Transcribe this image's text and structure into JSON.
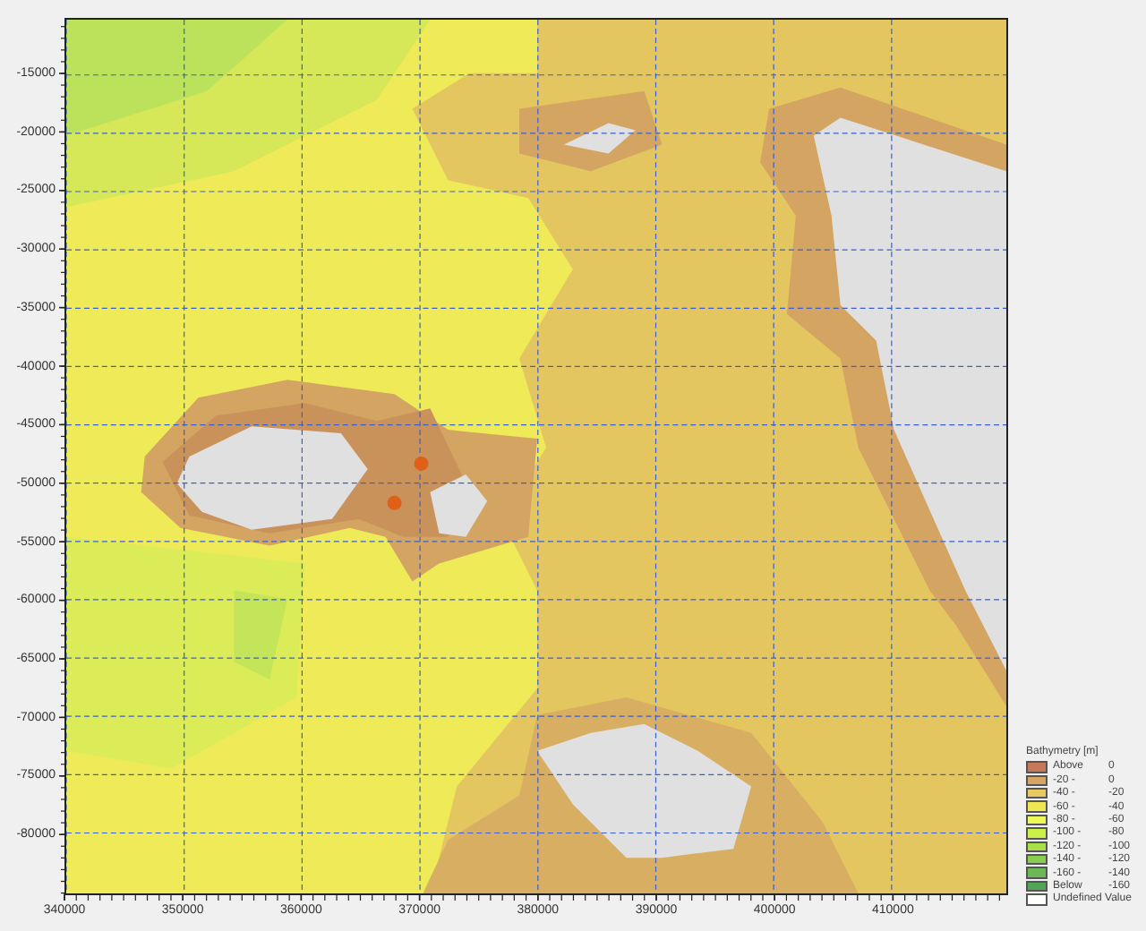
{
  "plot": {
    "y_ticks": [
      "-15000",
      "-20000",
      "-25000",
      "-30000",
      "-35000",
      "-40000",
      "-45000",
      "-50000",
      "-55000",
      "-60000",
      "-65000",
      "-70000",
      "-75000",
      "-80000"
    ],
    "x_ticks": [
      "340000",
      "350000",
      "360000",
      "370000",
      "380000",
      "390000",
      "400000",
      "410000"
    ]
  },
  "legend": {
    "title": "Bathymetry [m]",
    "items": [
      {
        "from": "Above",
        "to": "0",
        "color": "#c8785a"
      },
      {
        "from": "-20 -",
        "to": "0",
        "color": "#d8a464"
      },
      {
        "from": "-40 -",
        "to": "-20",
        "color": "#e8c860"
      },
      {
        "from": "-60 -",
        "to": "-40",
        "color": "#f0e654"
      },
      {
        "from": "-80 -",
        "to": "-60",
        "color": "#eef858"
      },
      {
        "from": "-100 -",
        "to": "-80",
        "color": "#ccf048"
      },
      {
        "from": "-120 -",
        "to": "-100",
        "color": "#a8e048"
      },
      {
        "from": "-140 -",
        "to": "-120",
        "color": "#88cc50"
      },
      {
        "from": "-160 -",
        "to": "-140",
        "color": "#6cb854"
      },
      {
        "from": "Below",
        "to": "-160",
        "color": "#54a458"
      },
      {
        "from": "Undefined Value",
        "color": "#ffffff"
      }
    ]
  }
}
